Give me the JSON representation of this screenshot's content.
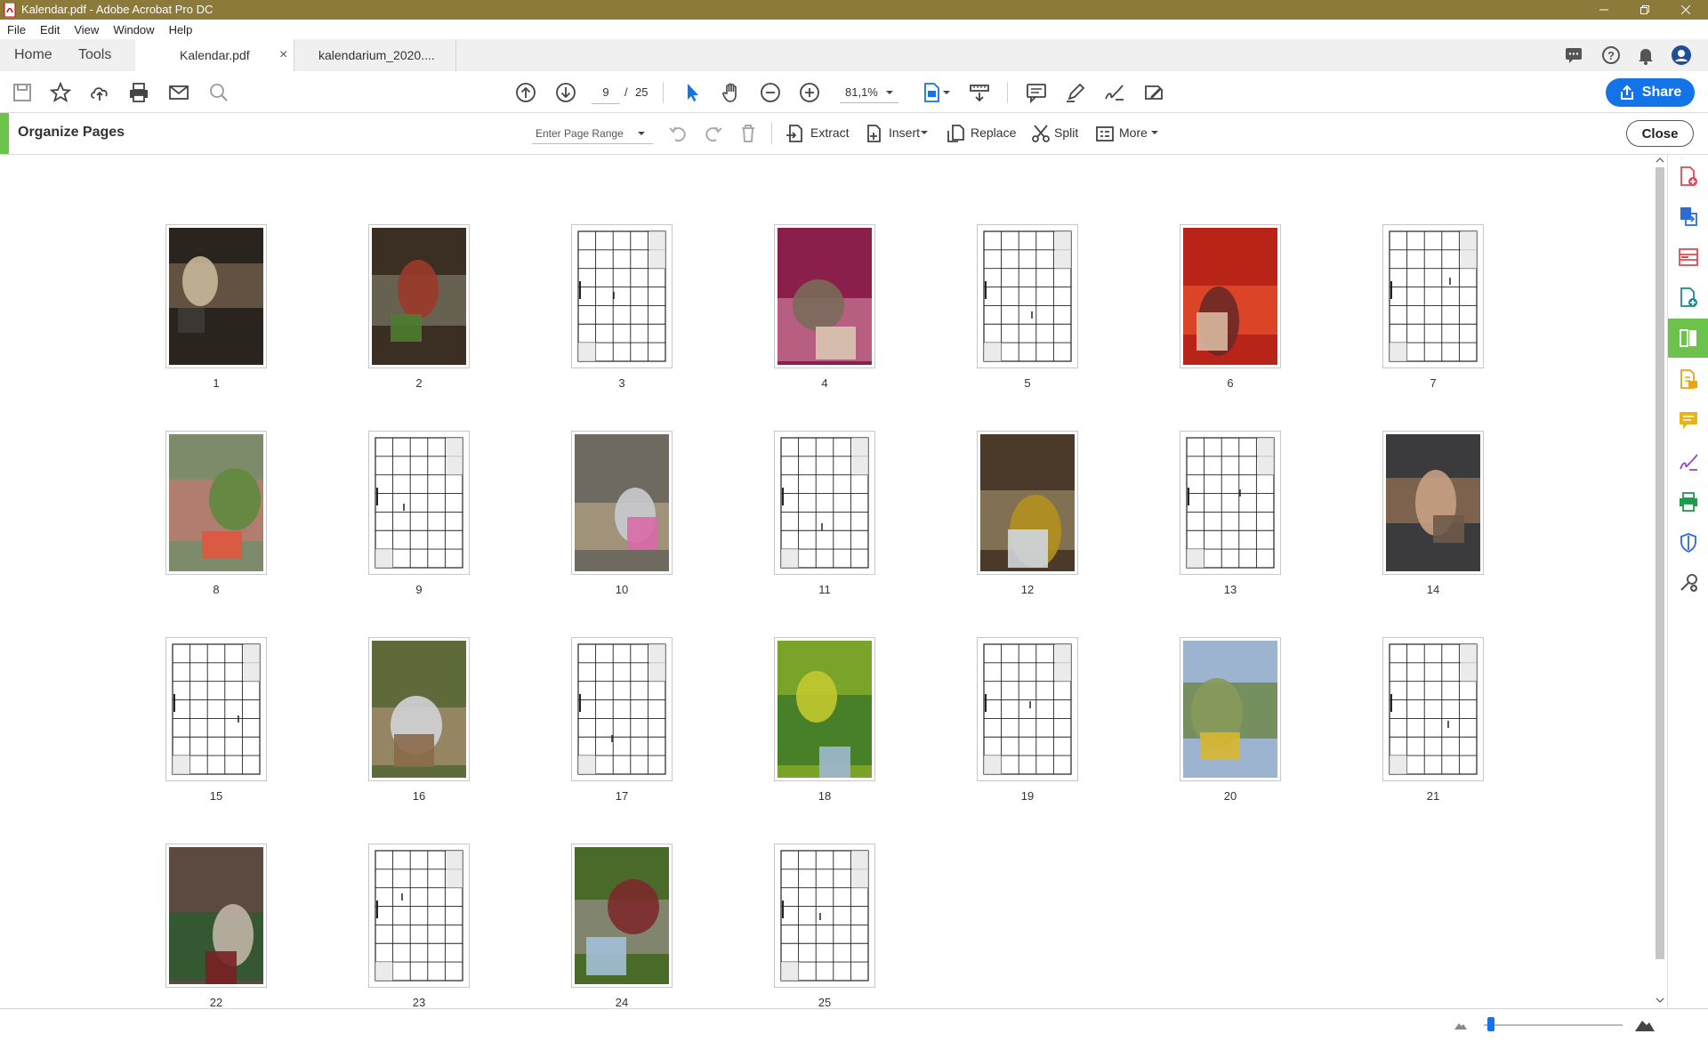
{
  "window": {
    "title": "Kalendar.pdf - Adobe Acrobat Pro DC"
  },
  "menu": [
    "File",
    "Edit",
    "View",
    "Window",
    "Help"
  ],
  "tabs": {
    "home": "Home",
    "tools": "Tools",
    "documents": [
      {
        "label": "Kalendar.pdf",
        "active": true,
        "close": "×"
      },
      {
        "label": "kalendarium_2020....",
        "active": false
      }
    ]
  },
  "toolbar": {
    "current_page": "9",
    "page_sep": "/",
    "total_pages": "25",
    "zoom": "81,1%",
    "share_label": "Share"
  },
  "organize": {
    "title": "Organize Pages",
    "range_placeholder": "Enter Page Range",
    "extract": "Extract",
    "insert": "Insert",
    "replace": "Replace",
    "split": "Split",
    "more": "More",
    "close": "Close"
  },
  "pages": [
    {
      "n": "1",
      "kind": "photo",
      "colors": [
        "#2a241e",
        "#6b5b48",
        "#c8b79a",
        "#3d3a34"
      ]
    },
    {
      "n": "2",
      "kind": "photo",
      "colors": [
        "#3b2f24",
        "#6f6a58",
        "#9c3a2a",
        "#4e7d2e"
      ]
    },
    {
      "n": "3",
      "kind": "calendar"
    },
    {
      "n": "4",
      "kind": "photo",
      "colors": [
        "#8a1f4b",
        "#c06a8a",
        "#7a6a5a",
        "#d9c7b0"
      ]
    },
    {
      "n": "5",
      "kind": "calendar"
    },
    {
      "n": "6",
      "kind": "photo",
      "colors": [
        "#b82418",
        "#e14a2a",
        "#6a2a26",
        "#d9b8a0"
      ]
    },
    {
      "n": "7",
      "kind": "calendar"
    },
    {
      "n": "8",
      "kind": "photo",
      "colors": [
        "#7d8b6a",
        "#b87a70",
        "#5f8a3e",
        "#e2553e"
      ]
    },
    {
      "n": "9",
      "kind": "calendar"
    },
    {
      "n": "10",
      "kind": "photo",
      "colors": [
        "#6f6a60",
        "#a99a7e",
        "#c9cbd0",
        "#d86aa8"
      ]
    },
    {
      "n": "11",
      "kind": "calendar"
    },
    {
      "n": "12",
      "kind": "photo",
      "colors": [
        "#4b3a2a",
        "#8c7a5a",
        "#b49020",
        "#cfd6de"
      ]
    },
    {
      "n": "13",
      "kind": "calendar"
    },
    {
      "n": "14",
      "kind": "photo",
      "colors": [
        "#3b3b3e",
        "#8a6a50",
        "#c7a184",
        "#6e5b4a"
      ]
    },
    {
      "n": "15",
      "kind": "calendar"
    },
    {
      "n": "16",
      "kind": "photo",
      "colors": [
        "#5f6a3a",
        "#a08a6a",
        "#d1d3d8",
        "#8a6a4a"
      ]
    },
    {
      "n": "17",
      "kind": "calendar"
    },
    {
      "n": "18",
      "kind": "photo",
      "colors": [
        "#7aa32a",
        "#3f7a2a",
        "#c2c92e",
        "#9fb8d0"
      ]
    },
    {
      "n": "19",
      "kind": "calendar"
    },
    {
      "n": "20",
      "kind": "photo",
      "colors": [
        "#9cb4cf",
        "#6f8a4a",
        "#8a9a5a",
        "#d8b630"
      ]
    },
    {
      "n": "21",
      "kind": "calendar"
    },
    {
      "n": "22",
      "kind": "photo",
      "colors": [
        "#5a4a40",
        "#2f5a30",
        "#c0b4a6",
        "#7a1f22"
      ]
    },
    {
      "n": "23",
      "kind": "calendar"
    },
    {
      "n": "24",
      "kind": "photo",
      "colors": [
        "#4a6a2a",
        "#8c8a7a",
        "#7b2a2a",
        "#a2c0d8"
      ]
    },
    {
      "n": "25",
      "kind": "calendar"
    }
  ],
  "colors": {
    "accent_green": "#6cc24a",
    "brand_blue": "#1473e6",
    "titlebar": "#8b7a3a"
  },
  "zoom_slider": {
    "value_fraction": 0.05
  }
}
